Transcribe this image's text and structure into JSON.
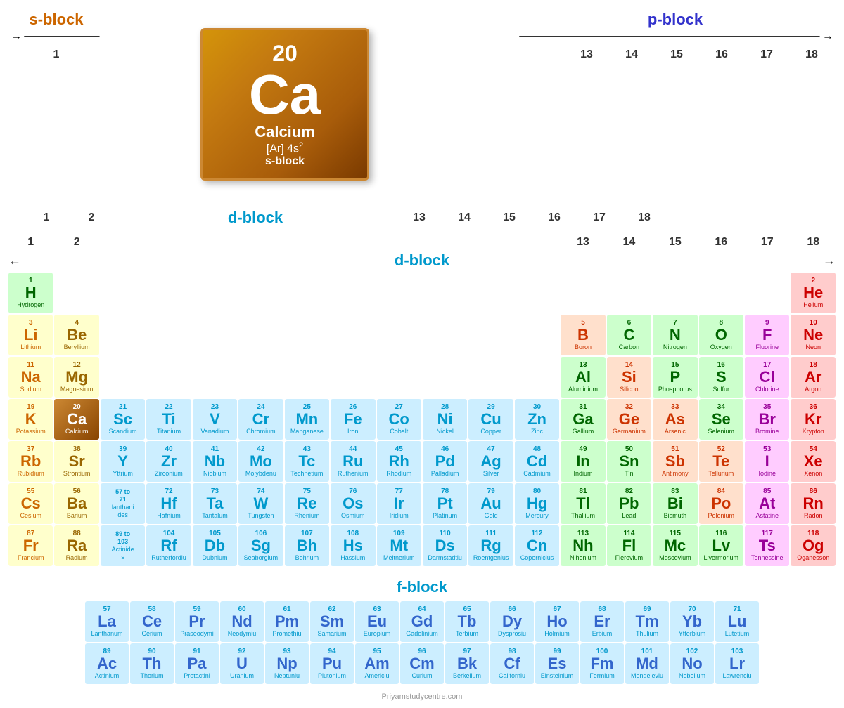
{
  "page": {
    "title": "Periodic Table",
    "watermark": "Priyamstudycentre.com"
  },
  "blocks": {
    "s_block": "s-block",
    "p_block": "p-block",
    "d_block": "d-block",
    "f_block": "f-block"
  },
  "ca_card": {
    "number": "20",
    "symbol": "Ca",
    "name": "Calcium",
    "config": "[Ar] 4s²",
    "block": "s-block"
  },
  "group_numbers": [
    "1",
    "2",
    "",
    "",
    "",
    "",
    "",
    "",
    "",
    "",
    "",
    "",
    "13",
    "14",
    "15",
    "16",
    "17",
    "18"
  ],
  "elements": {
    "H": {
      "number": "1",
      "symbol": "H",
      "name": "Hydrogen",
      "type": "hydrogen-cell"
    },
    "He": {
      "number": "2",
      "symbol": "He",
      "name": "Helium",
      "type": "noble"
    },
    "Li": {
      "number": "3",
      "symbol": "Li",
      "name": "Lithium",
      "type": "alkali"
    },
    "Be": {
      "number": "4",
      "symbol": "Be",
      "name": "Beryllium",
      "type": "alkaline"
    },
    "B": {
      "number": "5",
      "symbol": "B",
      "name": "Boron",
      "type": "metalloid"
    },
    "C": {
      "number": "6",
      "symbol": "C",
      "name": "Carbon",
      "type": "nonmetal"
    },
    "N": {
      "number": "7",
      "symbol": "N",
      "name": "Nitrogen",
      "type": "nonmetal"
    },
    "O": {
      "number": "8",
      "symbol": "O",
      "name": "Oxygen",
      "type": "nonmetal"
    },
    "F": {
      "number": "9",
      "symbol": "F",
      "name": "Fluorine",
      "type": "halogen"
    },
    "Ne": {
      "number": "10",
      "symbol": "Ne",
      "name": "Neon",
      "type": "noble"
    },
    "Na": {
      "number": "11",
      "symbol": "Na",
      "name": "Sodium",
      "type": "alkali"
    },
    "Mg": {
      "number": "12",
      "symbol": "Mg",
      "name": "Magnesium",
      "type": "alkaline"
    },
    "Al": {
      "number": "13",
      "symbol": "Al",
      "name": "Aluminium",
      "type": "post-transition"
    },
    "Si": {
      "number": "14",
      "symbol": "Si",
      "name": "Silicon",
      "type": "metalloid"
    },
    "P": {
      "number": "15",
      "symbol": "P",
      "name": "Phosphorus",
      "type": "nonmetal"
    },
    "S": {
      "number": "16",
      "symbol": "S",
      "name": "Sulfur",
      "type": "nonmetal"
    },
    "Cl": {
      "number": "17",
      "symbol": "Cl",
      "name": "Chlorine",
      "type": "halogen"
    },
    "Ar": {
      "number": "18",
      "symbol": "Ar",
      "name": "Argon",
      "type": "noble"
    },
    "K": {
      "number": "19",
      "symbol": "K",
      "name": "Potassium",
      "type": "alkali"
    },
    "Ca": {
      "number": "20",
      "symbol": "Ca",
      "name": "Calcium",
      "type": "ca-in-table"
    },
    "Sc": {
      "number": "21",
      "symbol": "Sc",
      "name": "Scandium",
      "type": "transition"
    },
    "Ti": {
      "number": "22",
      "symbol": "Ti",
      "name": "Titanium",
      "type": "transition"
    },
    "V": {
      "number": "23",
      "symbol": "V",
      "name": "Vanadium",
      "type": "transition"
    },
    "Cr": {
      "number": "24",
      "symbol": "Cr",
      "name": "Chromium",
      "type": "transition"
    },
    "Mn": {
      "number": "25",
      "symbol": "Mn",
      "name": "Manganese",
      "type": "transition"
    },
    "Fe": {
      "number": "26",
      "symbol": "Fe",
      "name": "Iron",
      "type": "transition"
    },
    "Co": {
      "number": "27",
      "symbol": "Co",
      "name": "Cobalt",
      "type": "transition"
    },
    "Ni": {
      "number": "28",
      "symbol": "Ni",
      "name": "Nickel",
      "type": "transition"
    },
    "Cu": {
      "number": "29",
      "symbol": "Cu",
      "name": "Copper",
      "type": "transition"
    },
    "Zn": {
      "number": "30",
      "symbol": "Zn",
      "name": "Zinc",
      "type": "transition"
    },
    "Ga": {
      "number": "31",
      "symbol": "Ga",
      "name": "Gallium",
      "type": "post-transition"
    },
    "Ge": {
      "number": "32",
      "symbol": "Ge",
      "name": "Germanium",
      "type": "metalloid"
    },
    "As": {
      "number": "33",
      "symbol": "As",
      "name": "Arsenic",
      "type": "metalloid"
    },
    "Se": {
      "number": "34",
      "symbol": "Se",
      "name": "Selenium",
      "type": "nonmetal"
    },
    "Br": {
      "number": "35",
      "symbol": "Br",
      "name": "Bromine",
      "type": "halogen"
    },
    "Kr": {
      "number": "36",
      "symbol": "Kr",
      "name": "Krypton",
      "type": "noble"
    },
    "Rb": {
      "number": "37",
      "symbol": "Rb",
      "name": "Rubidium",
      "type": "alkali"
    },
    "Sr": {
      "number": "38",
      "symbol": "Sr",
      "name": "Strontium",
      "type": "alkaline"
    },
    "Y": {
      "number": "39",
      "symbol": "Y",
      "name": "Yttrium",
      "type": "transition"
    },
    "Zr": {
      "number": "40",
      "symbol": "Zr",
      "name": "Zirconium",
      "type": "transition"
    },
    "Nb": {
      "number": "41",
      "symbol": "Nb",
      "name": "Niobium",
      "type": "transition"
    },
    "Mo": {
      "number": "42",
      "symbol": "Mo",
      "name": "Molybdenu",
      "type": "transition"
    },
    "Tc": {
      "number": "43",
      "symbol": "Tc",
      "name": "Technetium",
      "type": "transition"
    },
    "Ru": {
      "number": "44",
      "symbol": "Ru",
      "name": "Ruthenium",
      "type": "transition"
    },
    "Rh": {
      "number": "45",
      "symbol": "Rh",
      "name": "Rhodium",
      "type": "transition"
    },
    "Pd": {
      "number": "46",
      "symbol": "Pd",
      "name": "Palladium",
      "type": "transition"
    },
    "Ag": {
      "number": "47",
      "symbol": "Ag",
      "name": "Silver",
      "type": "transition"
    },
    "Cd": {
      "number": "48",
      "symbol": "Cd",
      "name": "Cadmium",
      "type": "transition"
    },
    "In": {
      "number": "49",
      "symbol": "In",
      "name": "Indium",
      "type": "post-transition"
    },
    "Sn": {
      "number": "50",
      "symbol": "Sn",
      "name": "Tin",
      "type": "post-transition"
    },
    "Sb": {
      "number": "51",
      "symbol": "Sb",
      "name": "Antimony",
      "type": "metalloid"
    },
    "Te": {
      "number": "52",
      "symbol": "Te",
      "name": "Tellurium",
      "type": "metalloid"
    },
    "I": {
      "number": "53",
      "symbol": "I",
      "name": "Iodine",
      "type": "halogen"
    },
    "Xe": {
      "number": "54",
      "symbol": "Xe",
      "name": "Xenon",
      "type": "noble"
    },
    "Cs": {
      "number": "55",
      "symbol": "Cs",
      "name": "Cesium",
      "type": "alkali"
    },
    "Ba": {
      "number": "56",
      "symbol": "Ba",
      "name": "Barium",
      "type": "alkaline"
    },
    "Hf": {
      "number": "72",
      "symbol": "Hf",
      "name": "Hafnium",
      "type": "transition"
    },
    "Ta": {
      "number": "73",
      "symbol": "Ta",
      "name": "Tantalum",
      "type": "transition"
    },
    "W": {
      "number": "74",
      "symbol": "W",
      "name": "Tungsten",
      "type": "transition"
    },
    "Re": {
      "number": "75",
      "symbol": "Re",
      "name": "Rhenium",
      "type": "transition"
    },
    "Os": {
      "number": "76",
      "symbol": "Os",
      "name": "Osmium",
      "type": "transition"
    },
    "Ir": {
      "number": "77",
      "symbol": "Ir",
      "name": "Iridium",
      "type": "transition"
    },
    "Pt": {
      "number": "78",
      "symbol": "Pt",
      "name": "Platinum",
      "type": "transition"
    },
    "Au": {
      "number": "79",
      "symbol": "Au",
      "name": "Gold",
      "type": "transition"
    },
    "Hg": {
      "number": "80",
      "symbol": "Hg",
      "name": "Mercury",
      "type": "transition"
    },
    "Tl": {
      "number": "81",
      "symbol": "Tl",
      "name": "Thallium",
      "type": "post-transition"
    },
    "Pb": {
      "number": "82",
      "symbol": "Pb",
      "name": "Lead",
      "type": "post-transition"
    },
    "Bi": {
      "number": "83",
      "symbol": "Bi",
      "name": "Bismuth",
      "type": "post-transition"
    },
    "Po": {
      "number": "84",
      "symbol": "Po",
      "name": "Polonium",
      "type": "metalloid"
    },
    "At": {
      "number": "85",
      "symbol": "At",
      "name": "Astatine",
      "type": "halogen"
    },
    "Rn": {
      "number": "86",
      "symbol": "Rn",
      "name": "Radon",
      "type": "noble"
    },
    "Fr": {
      "number": "87",
      "symbol": "Fr",
      "name": "Francium",
      "type": "alkali"
    },
    "Ra": {
      "number": "88",
      "symbol": "Ra",
      "name": "Radium",
      "type": "alkaline"
    },
    "Rf": {
      "number": "104",
      "symbol": "Rf",
      "name": "Rutherfordiu",
      "type": "transition"
    },
    "Db": {
      "number": "105",
      "symbol": "Db",
      "name": "Dubnium",
      "type": "transition"
    },
    "Sg": {
      "number": "106",
      "symbol": "Sg",
      "name": "Seaborgium",
      "type": "transition"
    },
    "Bh": {
      "number": "107",
      "symbol": "Bh",
      "name": "Bohrium",
      "type": "transition"
    },
    "Hs": {
      "number": "108",
      "symbol": "Hs",
      "name": "Hassium",
      "type": "transition"
    },
    "Mt": {
      "number": "109",
      "symbol": "Mt",
      "name": "Meitnerium",
      "type": "transition"
    },
    "Ds": {
      "number": "110",
      "symbol": "Ds",
      "name": "Darmstadtiu",
      "type": "transition"
    },
    "Rg": {
      "number": "111",
      "symbol": "Rg",
      "name": "Roentgenius",
      "type": "transition"
    },
    "Cn": {
      "number": "112",
      "symbol": "Cn",
      "name": "Copernicius",
      "type": "transition"
    },
    "Nh": {
      "number": "113",
      "symbol": "Nh",
      "name": "Nihonium",
      "type": "post-transition"
    },
    "Fl": {
      "number": "114",
      "symbol": "Fl",
      "name": "Flerovium",
      "type": "post-transition"
    },
    "Mc": {
      "number": "115",
      "symbol": "Mc",
      "name": "Moscovium",
      "type": "post-transition"
    },
    "Lv": {
      "number": "116",
      "symbol": "Lv",
      "name": "Livermorium",
      "type": "post-transition"
    },
    "Ts": {
      "number": "117",
      "symbol": "Ts",
      "name": "Tennessine",
      "type": "halogen"
    },
    "Og": {
      "number": "118",
      "symbol": "Og",
      "name": "Oganesson",
      "type": "noble"
    },
    "La": {
      "number": "57",
      "symbol": "La",
      "name": "Lanthanum",
      "type": "lanthanide"
    },
    "Ce": {
      "number": "58",
      "symbol": "Ce",
      "name": "Cerium",
      "type": "lanthanide"
    },
    "Pr": {
      "number": "59",
      "symbol": "Pr",
      "name": "Praseodymi",
      "type": "lanthanide"
    },
    "Nd": {
      "number": "60",
      "symbol": "Nd",
      "name": "Neodymiu",
      "type": "lanthanide"
    },
    "Pm": {
      "number": "61",
      "symbol": "Pm",
      "name": "Promethiu",
      "type": "lanthanide"
    },
    "Sm": {
      "number": "62",
      "symbol": "Sm",
      "name": "Samarium",
      "type": "lanthanide"
    },
    "Eu": {
      "number": "63",
      "symbol": "Eu",
      "name": "Europium",
      "type": "lanthanide"
    },
    "Gd": {
      "number": "64",
      "symbol": "Gd",
      "name": "Gadolinium",
      "type": "lanthanide"
    },
    "Tb": {
      "number": "65",
      "symbol": "Tb",
      "name": "Terbium",
      "type": "lanthanide"
    },
    "Dy": {
      "number": "66",
      "symbol": "Dy",
      "name": "Dysprosiu",
      "type": "lanthanide"
    },
    "Ho": {
      "number": "67",
      "symbol": "Ho",
      "name": "Holmium",
      "type": "lanthanide"
    },
    "Er": {
      "number": "68",
      "symbol": "Er",
      "name": "Erbium",
      "type": "lanthanide"
    },
    "Tm": {
      "number": "69",
      "symbol": "Tm",
      "name": "Thulium",
      "type": "lanthanide"
    },
    "Yb": {
      "number": "70",
      "symbol": "Yb",
      "name": "Ytterbium",
      "type": "lanthanide"
    },
    "Lu": {
      "number": "71",
      "symbol": "Lu",
      "name": "Lutetium",
      "type": "lanthanide"
    },
    "Ac": {
      "number": "89",
      "symbol": "Ac",
      "name": "Actinium",
      "type": "actinide"
    },
    "Th": {
      "number": "90",
      "symbol": "Th",
      "name": "Thorium",
      "type": "actinide"
    },
    "Pa": {
      "number": "91",
      "symbol": "Pa",
      "name": "Protactini",
      "type": "actinide"
    },
    "U": {
      "number": "92",
      "symbol": "U",
      "name": "Uranium",
      "type": "actinide"
    },
    "Np": {
      "number": "93",
      "symbol": "Np",
      "name": "Neptuniu",
      "type": "actinide"
    },
    "Pu": {
      "number": "94",
      "symbol": "Pu",
      "name": "Plutonium",
      "type": "actinide"
    },
    "Am": {
      "number": "95",
      "symbol": "Am",
      "name": "Americiu",
      "type": "actinide"
    },
    "Cm": {
      "number": "96",
      "symbol": "Cm",
      "name": "Curium",
      "type": "actinide"
    },
    "Bk": {
      "number": "97",
      "symbol": "Bk",
      "name": "Berkelium",
      "type": "actinide"
    },
    "Cf": {
      "number": "98",
      "symbol": "Cf",
      "name": "Californiu",
      "type": "actinide"
    },
    "Es": {
      "number": "99",
      "symbol": "Es",
      "name": "Einsteinium",
      "type": "actinide"
    },
    "Fm": {
      "number": "100",
      "symbol": "Fm",
      "name": "Fermium",
      "type": "actinide"
    },
    "Md": {
      "number": "101",
      "symbol": "Md",
      "name": "Mendeleviu",
      "type": "actinide"
    },
    "No": {
      "number": "102",
      "symbol": "No",
      "name": "Nobelium",
      "type": "actinide"
    },
    "Lr": {
      "number": "103",
      "symbol": "Lr",
      "name": "Lawrenciu",
      "type": "actinide"
    }
  }
}
